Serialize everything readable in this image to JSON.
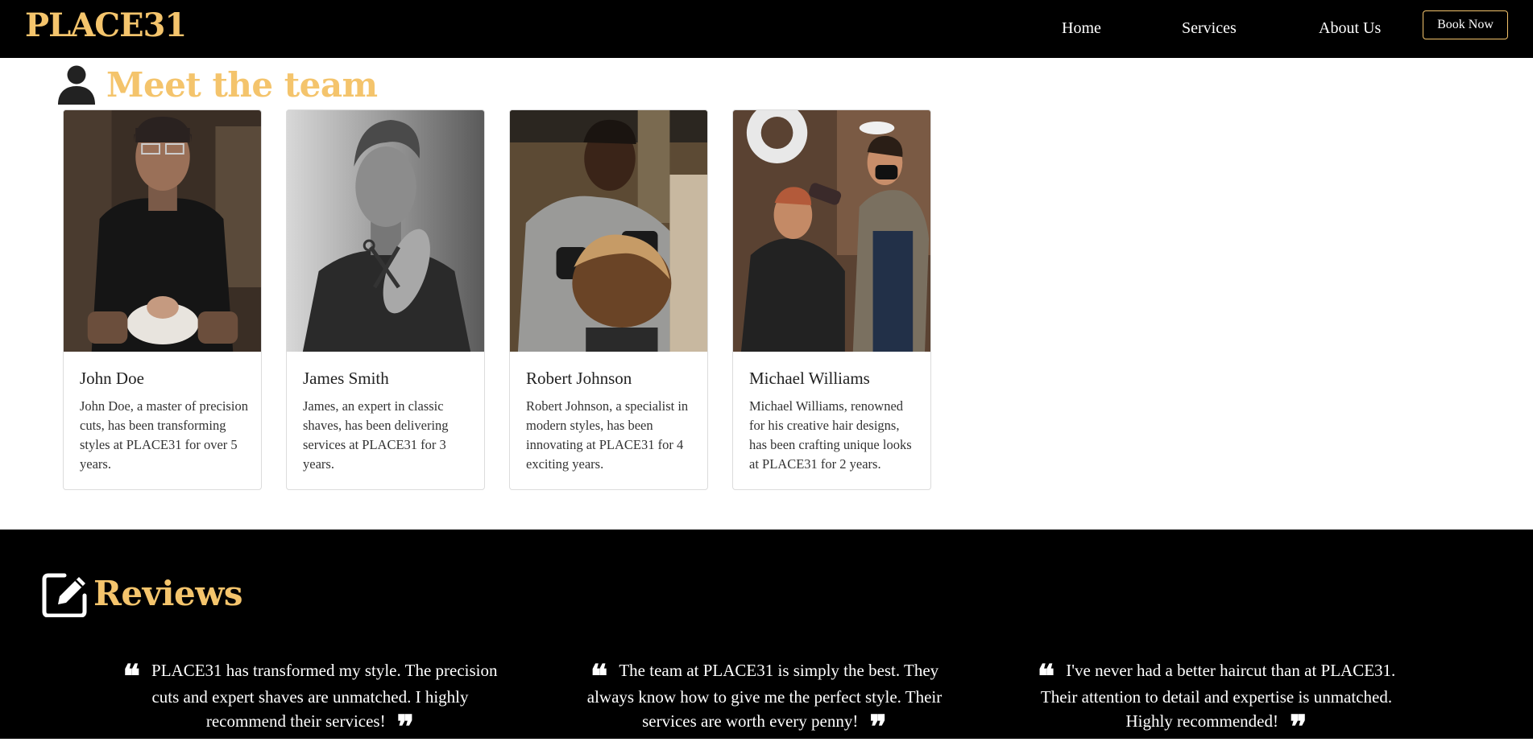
{
  "nav": {
    "brand": "PLACE31",
    "links": [
      "Home",
      "Services",
      "About Us"
    ],
    "cta": "Book Now"
  },
  "team": {
    "title": "Meet the team",
    "members": [
      {
        "name": "John Doe",
        "bio": "John Doe, a master of precision cuts, has been transforming styles at PLACE31 for over 5 years."
      },
      {
        "name": "James Smith",
        "bio": "James, an expert in classic shaves, has been delivering services at PLACE31 for 3 years."
      },
      {
        "name": "Robert Johnson",
        "bio": "Robert Johnson, a specialist in modern styles, has been innovating at PLACE31 for 4 exciting years."
      },
      {
        "name": "Michael Williams",
        "bio": "Michael Williams, renowned for his creative hair designs, has been crafting unique looks at PLACE31 for 2 years."
      }
    ]
  },
  "reviews": {
    "title": "Reviews",
    "items": [
      "PLACE31 has transformed my style. The precision cuts and expert shaves are unmatched. I highly recommend their services!",
      "The team at PLACE31 is simply the best. They always know how to give me the perfect style. Their services are worth every penny!",
      "I've never had a better haircut than at PLACE31. Their attention to detail and expertise is unmatched. Highly recommended!"
    ]
  },
  "colors": {
    "accent": "#f4c46c",
    "navbar_bg": "#000000",
    "reviews_bg": "#000000"
  }
}
